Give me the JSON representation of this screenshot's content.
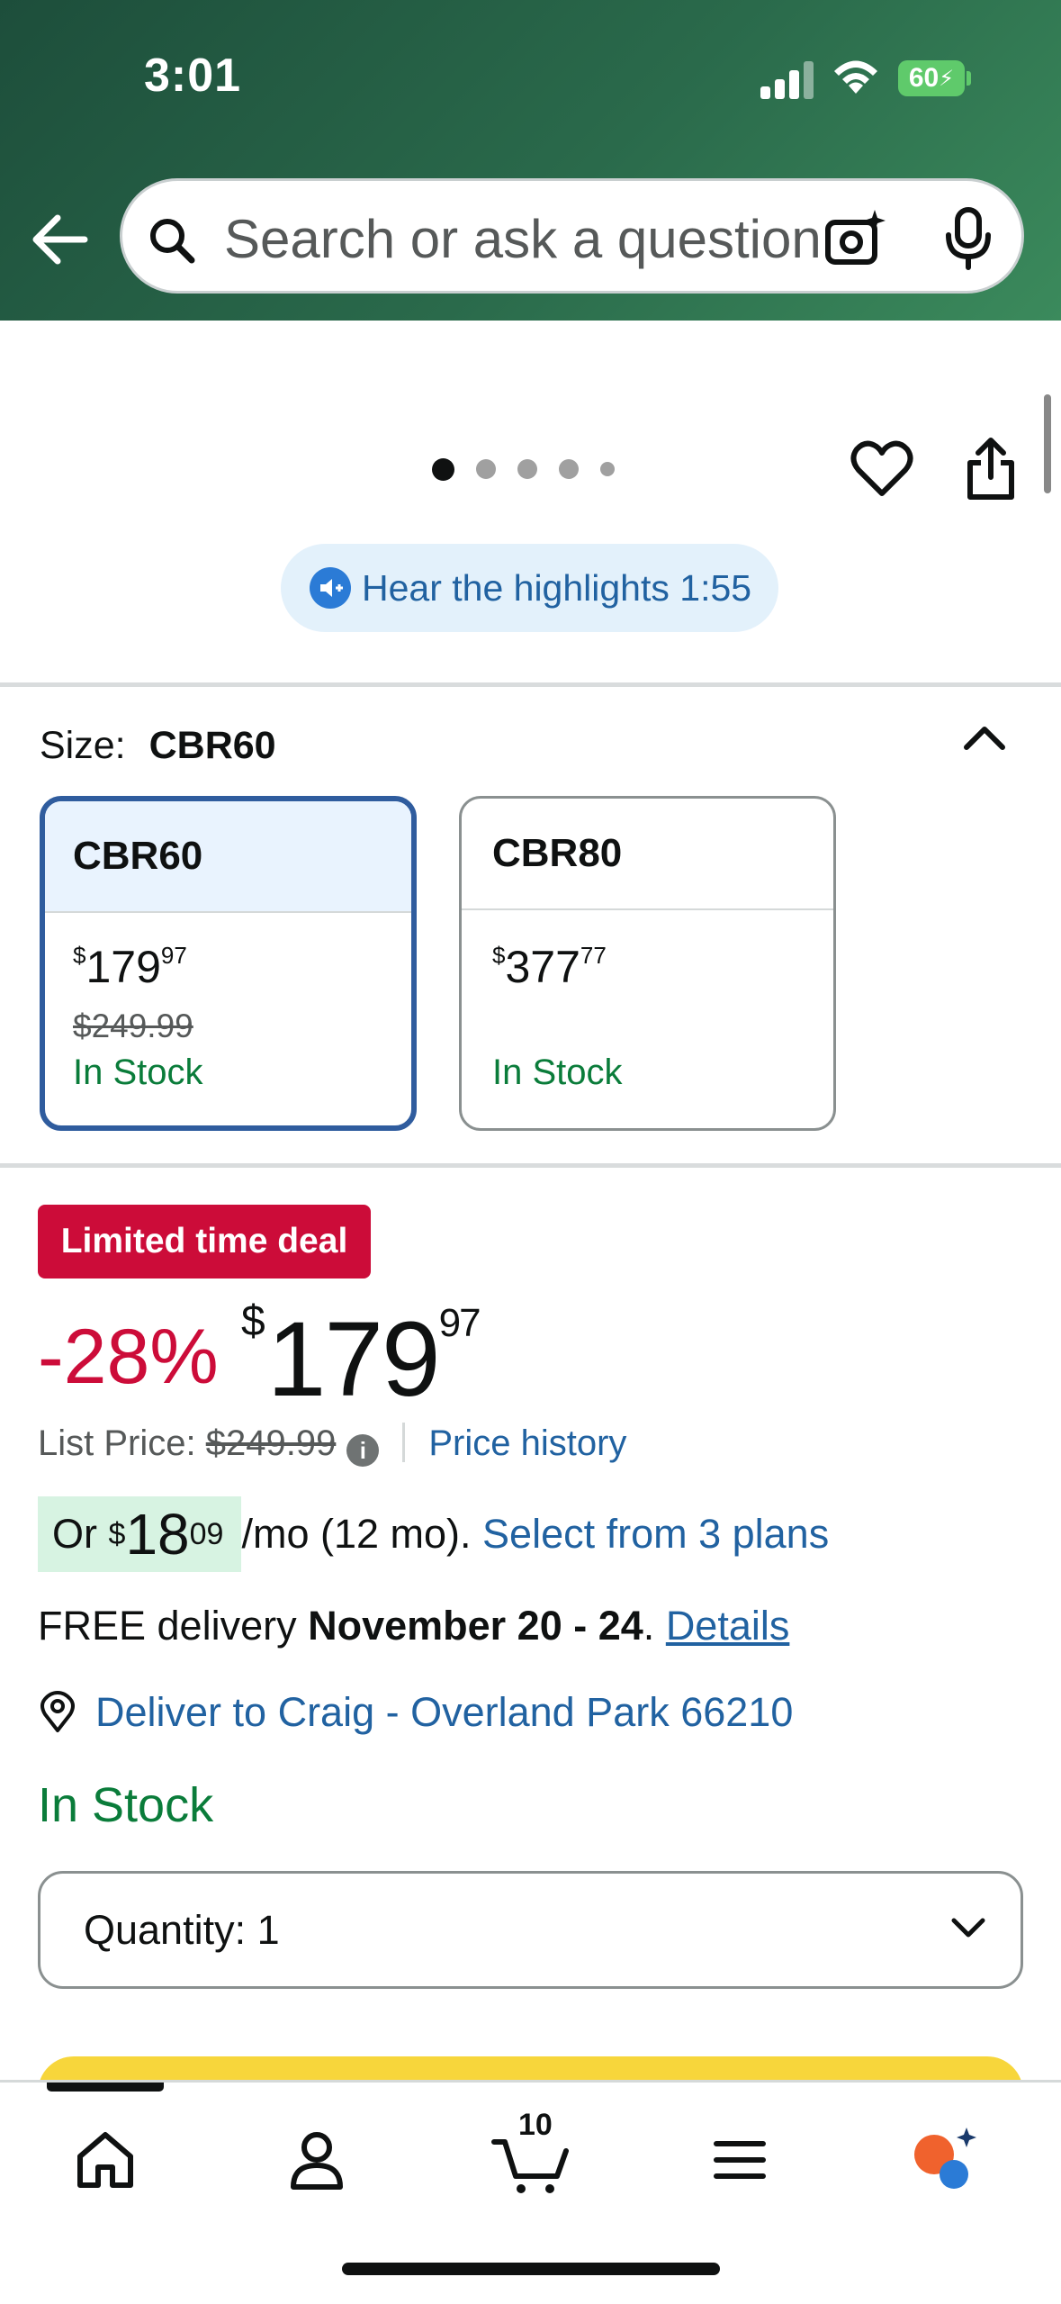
{
  "status_bar": {
    "time": "3:01",
    "battery": "60"
  },
  "search": {
    "placeholder": "Search or ask a question"
  },
  "gallery": {
    "dots_total": 5,
    "active_dot": 1
  },
  "highlights": {
    "label": "Hear the highlights 1:55"
  },
  "size_selector": {
    "label": "Size:",
    "selected": "CBR60",
    "options": [
      {
        "name": "CBR60",
        "price_dollars": "179",
        "price_cents": "97",
        "list_price": "$249.99",
        "stock": "In Stock",
        "selected": true
      },
      {
        "name": "CBR80",
        "price_dollars": "377",
        "price_cents": "77",
        "list_price": "",
        "stock": "In Stock",
        "selected": false
      }
    ]
  },
  "deal": {
    "badge": "Limited time deal",
    "discount": "-28%",
    "price_currency": "$",
    "price_dollars": "179",
    "price_cents": "97",
    "list_price_label": "List Price:",
    "list_price": "$249.99",
    "price_history": "Price history"
  },
  "installment": {
    "prefix": "Or",
    "currency": "$",
    "amount": "18",
    "cents": "09",
    "terms": "/mo (12 mo).",
    "plans_link": "Select from 3 plans"
  },
  "delivery": {
    "prefix": "FREE delivery",
    "dates": "November 20 - 24",
    "separator": ".",
    "details_link": "Details",
    "deliver_to": "Deliver to Craig - Overland Park 66210"
  },
  "stock_status": "In Stock",
  "quantity": {
    "label": "Quantity:",
    "value": "1"
  },
  "tab_bar": {
    "cart_count": "10",
    "tabs": [
      "home-icon",
      "account-icon",
      "cart-icon",
      "menu-icon",
      "assistant-icon"
    ]
  },
  "colors": {
    "header_green": "#2a6a4b",
    "deal_red": "#cc0c39",
    "link_blue": "#2162a1",
    "stock_green": "#0a7c3a",
    "selected_border": "#2f5c9e",
    "buy_yellow": "#f7d63b"
  }
}
